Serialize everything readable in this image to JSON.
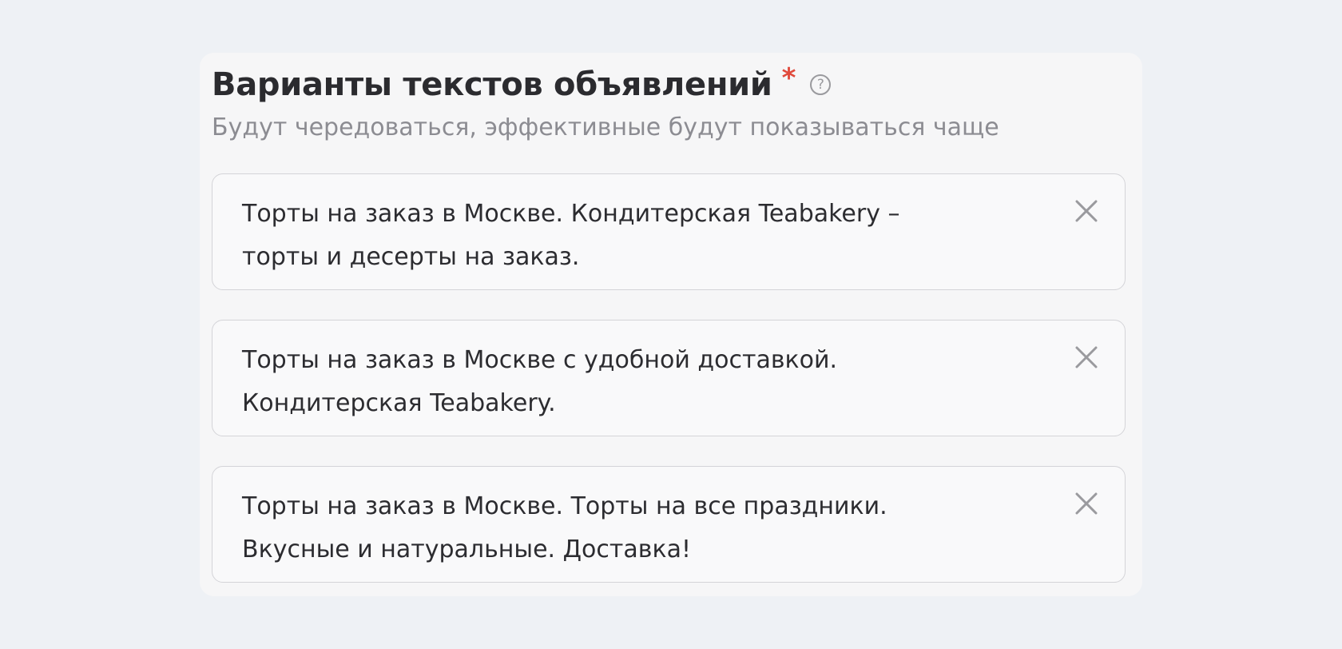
{
  "field": {
    "title": "Варианты текстов объявлений",
    "required_mark": "*",
    "help_icon": "question-circle-icon",
    "help_glyph": "?",
    "subtitle": "Будут чередоваться, эффективные будут показываться чаще"
  },
  "variants": [
    {
      "text": "Торты на заказ в Москве. Кондитерская Teabakery –\nторты и десерты на заказ.",
      "remove_icon": "close-icon"
    },
    {
      "text": "Торты на заказ в Москве с удобной доставкой.\nКондитерская Teabakery.",
      "remove_icon": "close-icon"
    },
    {
      "text": "Торты на заказ в Москве. Торты на все праздники.\nВкусные и натуральные. Доставка!",
      "remove_icon": "close-icon"
    }
  ],
  "colors": {
    "page_background": "#eef1f5",
    "panel_background": "#f6f6f7",
    "required": "#e0493b",
    "muted_text": "#8c8c92",
    "icon_gray": "#9a9a9e"
  }
}
